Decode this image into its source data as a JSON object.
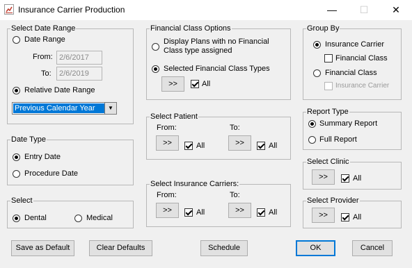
{
  "window": {
    "title": "Insurance Carrier Production",
    "minimize": "—",
    "maximize": "☐",
    "close": "✕"
  },
  "date_range": {
    "legend": "Select Date Range",
    "date_range_label": "Date Range",
    "from_label": "From:",
    "from_value": "2/6/2017",
    "to_label": "To:",
    "to_value": "2/6/2019",
    "relative_label": "Relative Date Range",
    "relative_value": "Previous Calendar Year",
    "selected": "relative"
  },
  "date_type": {
    "legend": "Date Type",
    "entry": "Entry Date",
    "procedure": "Procedure Date",
    "selected": "entry"
  },
  "select": {
    "legend": "Select",
    "dental": "Dental",
    "medical": "Medical",
    "selected": "dental"
  },
  "financial_class": {
    "legend": "Financial Class Options",
    "option1_line1": "Display Plans with no Financial",
    "option1_line2": "Class type assigned",
    "option2": "Selected Financial Class Types",
    "picker": ">>",
    "all": "All",
    "selected": "option2"
  },
  "patient": {
    "legend": "Select Patient",
    "from": "From:",
    "to": "To:",
    "picker": ">>",
    "all": "All"
  },
  "carriers": {
    "legend": "Select Insurance Carriers:",
    "from": "From:",
    "to": "To:",
    "picker": ">>",
    "all": "All"
  },
  "group_by": {
    "legend": "Group By",
    "insurance_carrier": "Insurance Carrier",
    "financial_class_sub": "Financial Class",
    "financial_class": "Financial Class",
    "insurance_carrier_sub": "Insurance Carrier",
    "selected": "insurance_carrier"
  },
  "report_type": {
    "legend": "Report Type",
    "summary": "Summary Report",
    "full": "Full Report",
    "selected": "summary"
  },
  "clinic": {
    "legend": "Select Clinic",
    "picker": ">>",
    "all": "All"
  },
  "provider": {
    "legend": "Select Provider",
    "picker": ">>",
    "all": "All"
  },
  "footer": {
    "save_default": "Save as Default",
    "clear_defaults": "Clear Defaults",
    "schedule": "Schedule",
    "ok": "OK",
    "cancel": "Cancel"
  },
  "colors": {
    "accent": "#0078d7",
    "background": "#f0f0f0"
  }
}
